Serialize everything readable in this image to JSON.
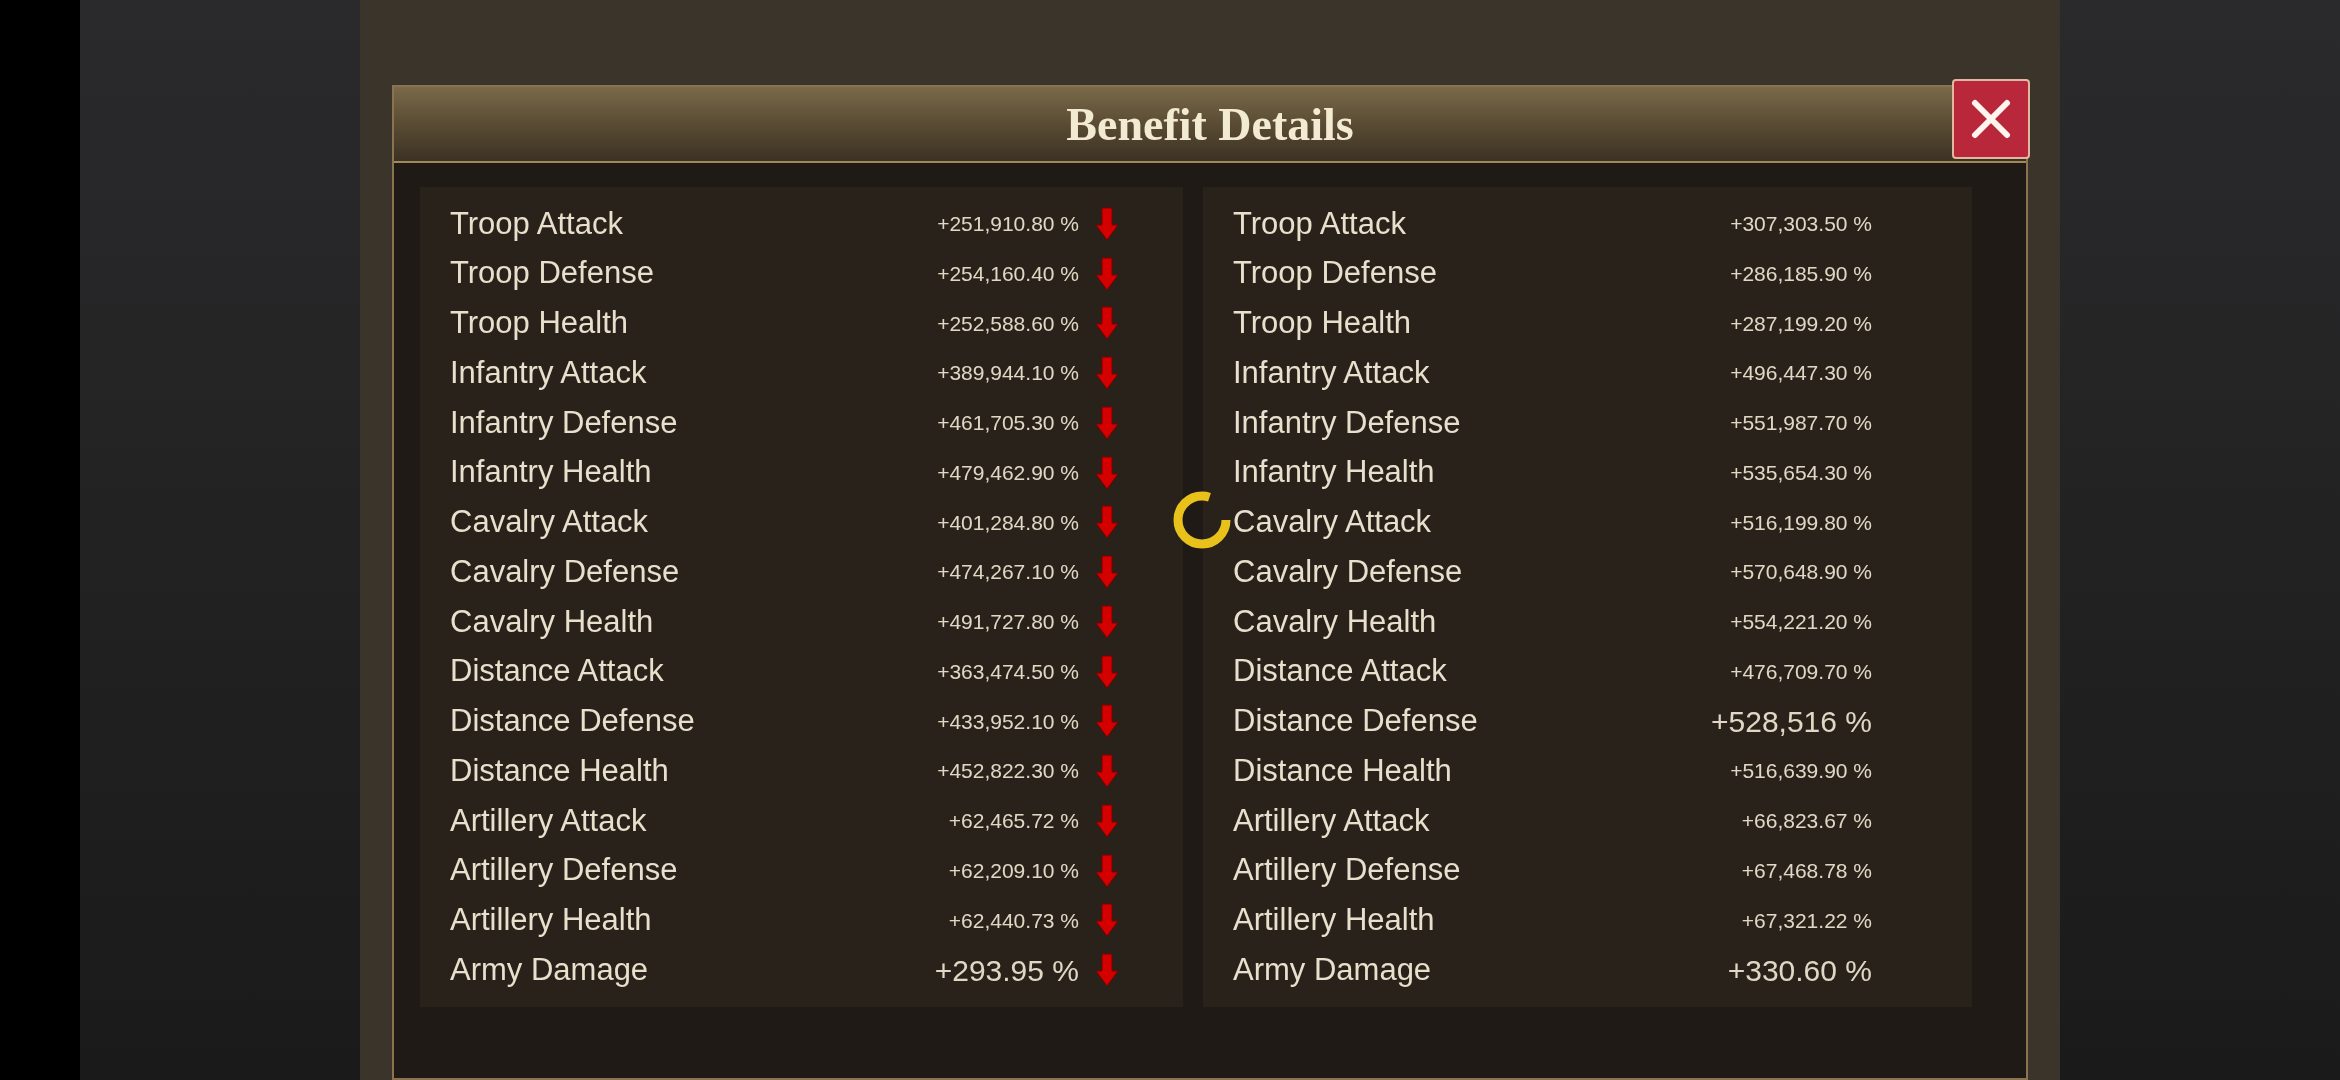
{
  "dialog": {
    "title": "Benefit Details",
    "loading": true
  },
  "columns": [
    {
      "rows": [
        {
          "label": "Troop Attack",
          "value": "+251,910.80 %",
          "large": false,
          "decreased": true
        },
        {
          "label": "Troop Defense",
          "value": "+254,160.40 %",
          "large": false,
          "decreased": true
        },
        {
          "label": "Troop Health",
          "value": "+252,588.60 %",
          "large": false,
          "decreased": true
        },
        {
          "label": "Infantry Attack",
          "value": "+389,944.10 %",
          "large": false,
          "decreased": true
        },
        {
          "label": "Infantry Defense",
          "value": "+461,705.30 %",
          "large": false,
          "decreased": true
        },
        {
          "label": "Infantry Health",
          "value": "+479,462.90 %",
          "large": false,
          "decreased": true
        },
        {
          "label": "Cavalry Attack",
          "value": "+401,284.80 %",
          "large": false,
          "decreased": true
        },
        {
          "label": "Cavalry Defense",
          "value": "+474,267.10 %",
          "large": false,
          "decreased": true
        },
        {
          "label": "Cavalry Health",
          "value": "+491,727.80 %",
          "large": false,
          "decreased": true
        },
        {
          "label": "Distance Attack",
          "value": "+363,474.50 %",
          "large": false,
          "decreased": true
        },
        {
          "label": "Distance Defense",
          "value": "+433,952.10 %",
          "large": false,
          "decreased": true
        },
        {
          "label": "Distance Health",
          "value": "+452,822.30 %",
          "large": false,
          "decreased": true
        },
        {
          "label": "Artillery Attack",
          "value": "+62,465.72 %",
          "large": false,
          "decreased": true
        },
        {
          "label": "Artillery Defense",
          "value": "+62,209.10 %",
          "large": false,
          "decreased": true
        },
        {
          "label": "Artillery Health",
          "value": "+62,440.73 %",
          "large": false,
          "decreased": true
        },
        {
          "label": "Army Damage",
          "value": "+293.95 %",
          "large": true,
          "decreased": true
        }
      ]
    },
    {
      "rows": [
        {
          "label": "Troop Attack",
          "value": "+307,303.50 %",
          "large": false
        },
        {
          "label": "Troop Defense",
          "value": "+286,185.90 %",
          "large": false
        },
        {
          "label": "Troop Health",
          "value": "+287,199.20 %",
          "large": false
        },
        {
          "label": "Infantry Attack",
          "value": "+496,447.30 %",
          "large": false
        },
        {
          "label": "Infantry Defense",
          "value": "+551,987.70 %",
          "large": false
        },
        {
          "label": "Infantry Health",
          "value": "+535,654.30 %",
          "large": false
        },
        {
          "label": "Cavalry Attack",
          "value": "+516,199.80 %",
          "large": false
        },
        {
          "label": "Cavalry Defense",
          "value": "+570,648.90 %",
          "large": false
        },
        {
          "label": "Cavalry Health",
          "value": "+554,221.20 %",
          "large": false
        },
        {
          "label": "Distance Attack",
          "value": "+476,709.70 %",
          "large": false
        },
        {
          "label": "Distance Defense",
          "value": "+528,516 %",
          "large": true
        },
        {
          "label": "Distance Health",
          "value": "+516,639.90 %",
          "large": false
        },
        {
          "label": "Artillery Attack",
          "value": "+66,823.67 %",
          "large": false
        },
        {
          "label": "Artillery Defense",
          "value": "+67,468.78 %",
          "large": false
        },
        {
          "label": "Artillery Health",
          "value": "+67,321.22 %",
          "large": false
        },
        {
          "label": "Army Damage",
          "value": "+330.60 %",
          "large": true
        }
      ]
    }
  ]
}
